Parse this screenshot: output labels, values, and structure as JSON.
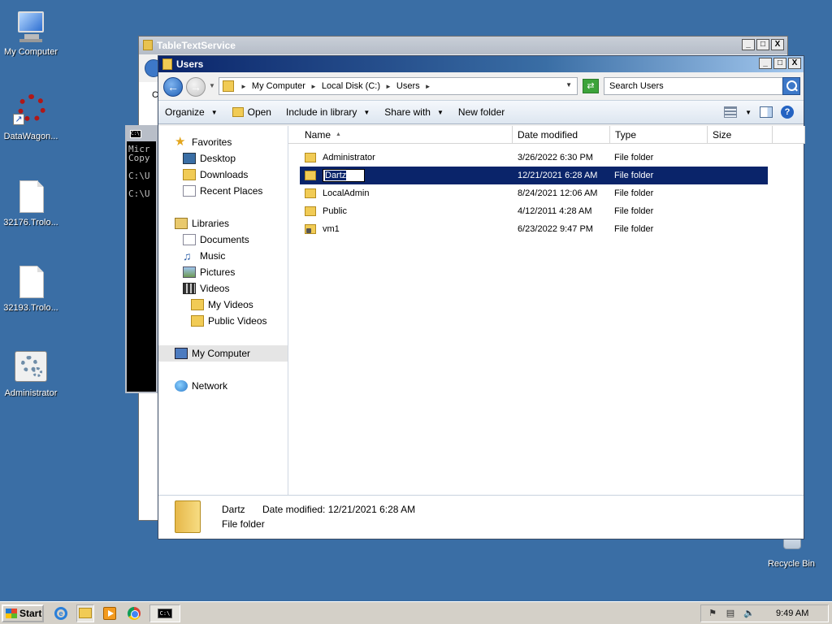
{
  "desktop": {
    "icons": [
      {
        "label": "My Computer"
      },
      {
        "label": "DataWagon..."
      },
      {
        "label": "32176.Trolo..."
      },
      {
        "label": "32193.Trolo..."
      },
      {
        "label": "Administrator"
      },
      {
        "label": "Recycle Bin"
      }
    ]
  },
  "background_window": {
    "title": "TableTextService",
    "letter": "C"
  },
  "cmd_window": {
    "lines": "Micr\nCopy\n\nC:\\U\n\nC:\\U",
    "icon_text": "C:\\"
  },
  "explorer": {
    "title": "Users",
    "window_controls": {
      "minimize": "_",
      "maximize": "□",
      "close": "X"
    },
    "address": {
      "crumbs": [
        "My Computer",
        "Local Disk (C:)",
        "Users"
      ]
    },
    "search": {
      "placeholder": "Search Users"
    },
    "toolbar": {
      "organize": "Organize",
      "open": "Open",
      "include": "Include in library",
      "share": "Share with",
      "new_folder": "New folder"
    },
    "nav": {
      "favorites": "Favorites",
      "desktop": "Desktop",
      "downloads": "Downloads",
      "recent": "Recent Places",
      "libraries": "Libraries",
      "documents": "Documents",
      "music": "Music",
      "pictures": "Pictures",
      "videos": "Videos",
      "my_videos": "My Videos",
      "public_videos": "Public Videos",
      "my_computer": "My Computer",
      "network": "Network"
    },
    "columns": {
      "name": "Name",
      "date": "Date modified",
      "type": "Type",
      "size": "Size"
    },
    "files": [
      {
        "name": "Administrator",
        "date": "3/26/2022 6:30 PM",
        "type": "File folder"
      },
      {
        "name": "Dartz",
        "date": "12/21/2021 6:28 AM",
        "type": "File folder"
      },
      {
        "name": "LocalAdmin",
        "date": "8/24/2021 12:06 AM",
        "type": "File folder"
      },
      {
        "name": "Public",
        "date": "4/12/2011 4:28 AM",
        "type": "File folder"
      },
      {
        "name": "vm1",
        "date": "6/23/2022 9:47 PM",
        "type": "File folder"
      }
    ],
    "details": {
      "name": "Dartz",
      "date_label": "Date modified:  12/21/2021 6:28 AM",
      "type": "File folder"
    }
  },
  "taskbar": {
    "start": "Start",
    "clock": "9:49 AM"
  }
}
